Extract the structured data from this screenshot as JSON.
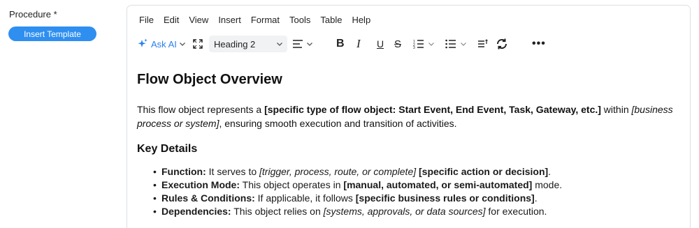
{
  "field": {
    "label": "Procedure *",
    "insert_template_label": "Insert Template"
  },
  "menu": [
    "File",
    "Edit",
    "View",
    "Insert",
    "Format",
    "Tools",
    "Table",
    "Help"
  ],
  "toolbar": {
    "ask_ai_label": "Ask AI",
    "heading_value": "Heading 2",
    "bold_glyph": "B",
    "italic_glyph": "I",
    "underline_glyph": "U",
    "strike_glyph": "S",
    "more_glyph": "•••",
    "accent_color": "#2a7ef0"
  },
  "document": {
    "title": "Flow Object Overview",
    "intro": {
      "t1": "This flow object represents a ",
      "b1": "[specific type of flow object: Start Event, End Event, Task, Gateway, etc.]",
      "t2": " within ",
      "i1": "[business process or system]",
      "t3": ", ensuring smooth execution and transition of activities."
    },
    "key_details_heading": "Key Details",
    "items": [
      {
        "label": "Function:",
        "t1": " It serves to ",
        "i1": "[trigger, process, route, or complete]",
        "t2": " ",
        "b1": "[specific action or decision]",
        "t3": "."
      },
      {
        "label": "Execution Mode:",
        "t1": " This object operates in ",
        "i1": "",
        "t2": "",
        "b1": "[manual, automated, or semi-automated]",
        "t3": " mode."
      },
      {
        "label": "Rules & Conditions:",
        "t1": " If applicable, it follows ",
        "i1": "",
        "t2": "",
        "b1": "[specific business rules or conditions]",
        "t3": "."
      },
      {
        "label": "Dependencies:",
        "t1": " This object relies on ",
        "i1": "[systems, approvals, or data sources]",
        "t2": " for execution.",
        "b1": "",
        "t3": ""
      }
    ]
  }
}
